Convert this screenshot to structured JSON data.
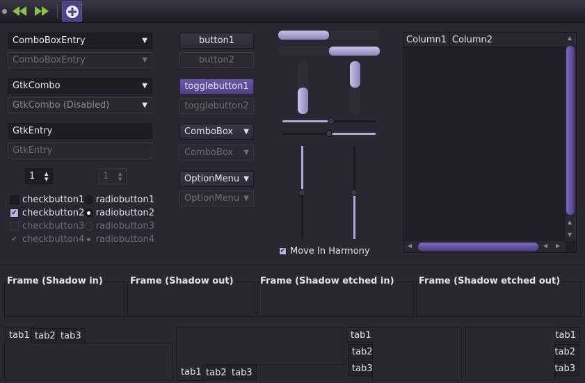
{
  "toolbar": {
    "icons": [
      "back-icon",
      "forward-icon",
      "add-icon"
    ]
  },
  "col1": {
    "comboentry1": "ComboBoxEntry",
    "comboentry2": "ComboBoxEntry",
    "gtkcombo1": "GtkCombo",
    "gtkcombo2": "GtkCombo (Disabled)",
    "entry1": "GtkEntry",
    "entry2": "GtkEntry",
    "spin1": "1",
    "spin2": "1",
    "checks": [
      "checkbutton1",
      "checkbutton2",
      "checkbutton3",
      "checkbutton4"
    ],
    "radios": [
      "radiobutton1",
      "radiobutton2",
      "radiobutton3",
      "radiobutton4"
    ]
  },
  "col2": {
    "button1": "button1",
    "button2": "button2",
    "toggle1": "togglebutton1",
    "toggle2": "togglebutton2",
    "combobox1": "ComboBox",
    "combobox2": "ComboBox",
    "option1": "OptionMenu",
    "option2": "OptionMenu"
  },
  "scales": {
    "harmony_label": "Move In Harmony"
  },
  "tree": {
    "columns": [
      "Column1",
      "Column2"
    ]
  },
  "frames": [
    "Frame (Shadow in)",
    "Frame (Shadow out)",
    "Frame (Shadow etched in)",
    "Frame (Shadow etched out)"
  ],
  "notebooks": {
    "tabs": [
      "tab1",
      "tab2",
      "tab3"
    ]
  },
  "colors": {
    "accent": "#4f3f84",
    "background": "#2a2733"
  }
}
